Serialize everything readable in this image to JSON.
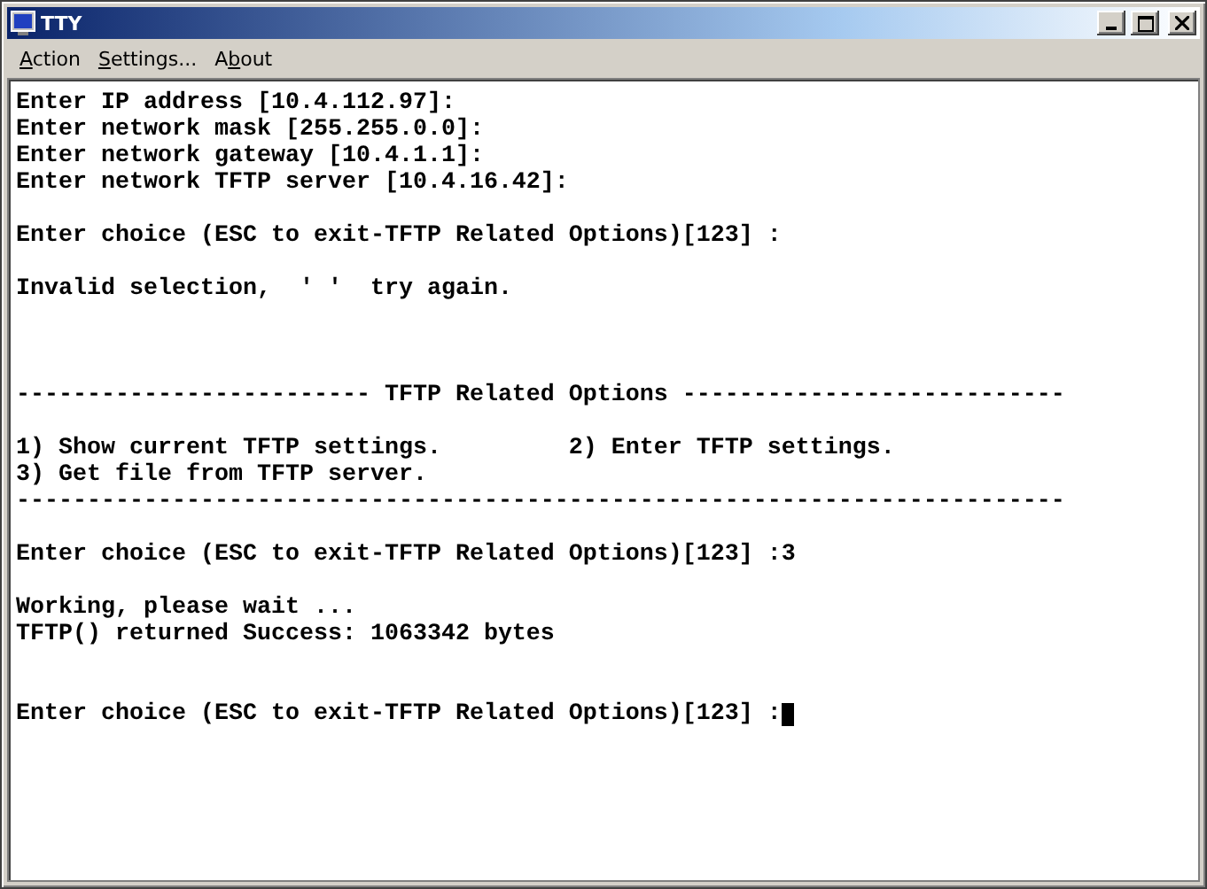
{
  "window": {
    "title": "TTY"
  },
  "menu": [
    {
      "key": "A",
      "post": "ction"
    },
    {
      "key": "S",
      "post": "ettings..."
    },
    {
      "pre": "A",
      "key": "b",
      "post": "out"
    }
  ],
  "terminal": {
    "lines": [
      {
        "kind": "text",
        "text": "Enter IP address [10.4.112.97]:"
      },
      {
        "kind": "text",
        "text": "Enter network mask [255.255.0.0]:"
      },
      {
        "kind": "text",
        "text": "Enter network gateway [10.4.1.1]:"
      },
      {
        "kind": "text",
        "text": "Enter network TFTP server [10.4.16.42]:"
      },
      {
        "kind": "blank"
      },
      {
        "kind": "text",
        "text": "Enter choice (ESC to exit-TFTP Related Options)[123] :"
      },
      {
        "kind": "blank"
      },
      {
        "kind": "text",
        "text": "Invalid selection,  ' '  try again."
      },
      {
        "kind": "blank"
      },
      {
        "kind": "blank"
      },
      {
        "kind": "blank"
      },
      {
        "kind": "text",
        "text": "------------------------- TFTP Related Options ---------------------------"
      },
      {
        "kind": "blank"
      },
      {
        "kind": "text",
        "text": "1) Show current TFTP settings.         2) Enter TFTP settings."
      },
      {
        "kind": "text",
        "text": "3) Get file from TFTP server."
      },
      {
        "kind": "text",
        "text": "--------------------------------------------------------------------------"
      },
      {
        "kind": "blank"
      },
      {
        "kind": "text",
        "text": "Enter choice (ESC to exit-TFTP Related Options)[123] :3"
      },
      {
        "kind": "blank"
      },
      {
        "kind": "text",
        "text": "Working, please wait ..."
      },
      {
        "kind": "text",
        "text": "TFTP() returned Success: 1063342 bytes"
      },
      {
        "kind": "blank"
      },
      {
        "kind": "blank"
      },
      {
        "kind": "prompt",
        "text": "Enter choice (ESC to exit-TFTP Related Options)[123] :"
      }
    ]
  }
}
